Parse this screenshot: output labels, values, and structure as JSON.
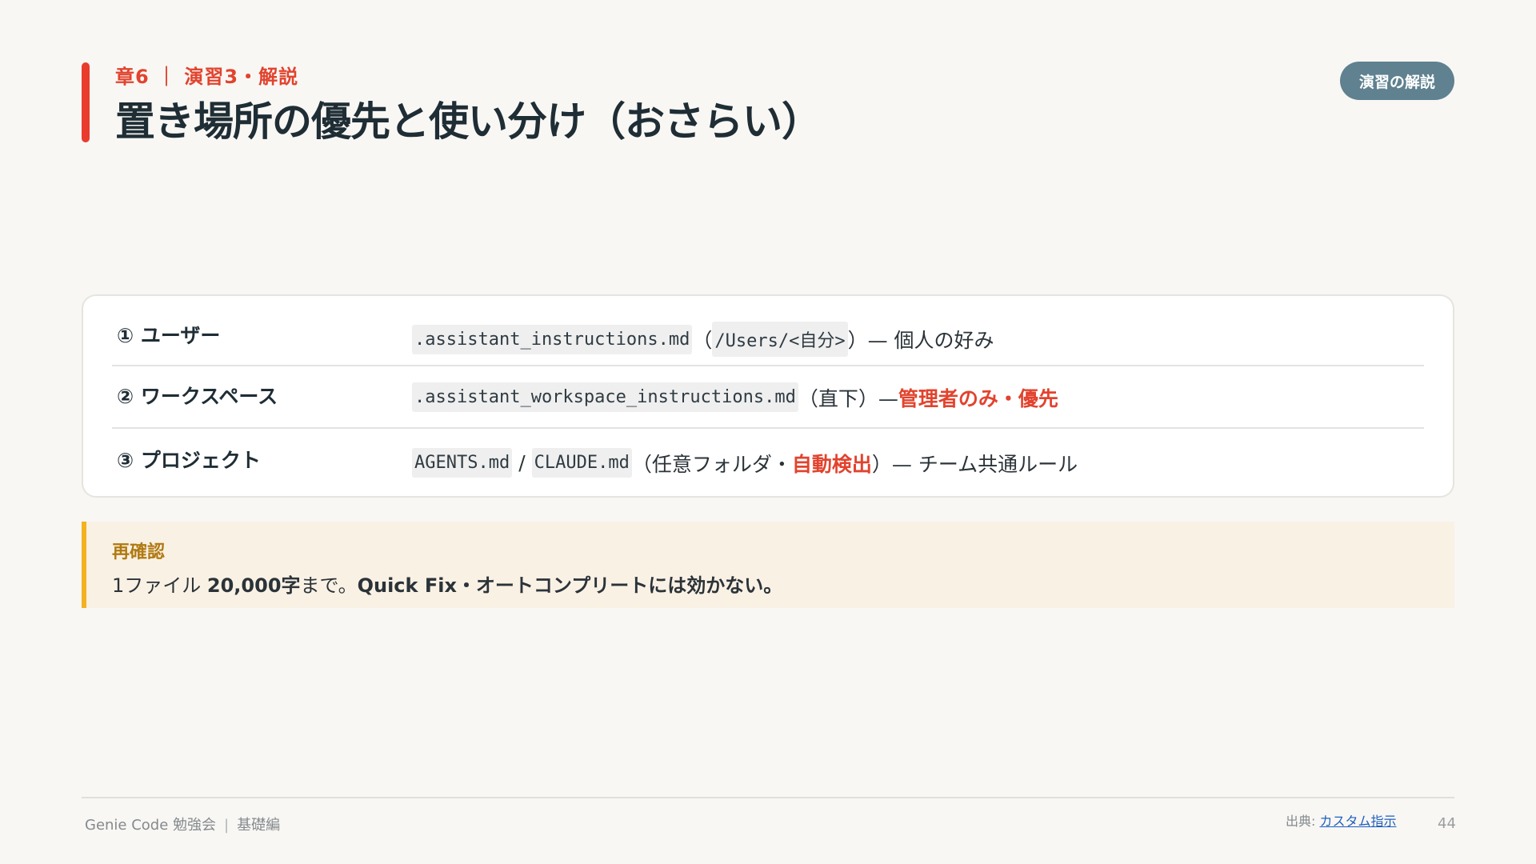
{
  "header": {
    "kicker": "章6 ｜ 演習3・解説",
    "title": "置き場所の優先と使い分け（おさらい）",
    "badge": "演習の解説"
  },
  "table": {
    "rows": [
      {
        "label": "① ユーザー",
        "code1": ".assistant_instructions.md",
        "paren_open": "（",
        "code_path": "/Users/<自分>",
        "rest": "）— 個人の好み"
      },
      {
        "label": "② ワークスペース",
        "code1": ".assistant_workspace_instructions.md",
        "rest": "（直下）— ",
        "highlight": "管理者のみ・優先"
      },
      {
        "label": "③ プロジェクト",
        "code1": "AGENTS.md",
        "slash": "/",
        "code2": "CLAUDE.md",
        "rest_before": "（任意フォルダ・",
        "highlight": "自動検出",
        "rest_after": "）— チーム共通ルール"
      }
    ]
  },
  "note": {
    "title": "再確認",
    "prefix": "1ファイル ",
    "bold1": "20,000字",
    "mid": "まで。",
    "bold2": "Quick Fix・オートコンプリートには効かない。"
  },
  "footer": {
    "left_a": "Genie Code 勉強会",
    "pipe": "|",
    "left_b": "基礎編",
    "source_label": "出典: ",
    "source_link": "カスタム指示",
    "page_number": "44"
  },
  "colors": {
    "accent": "#ea3c2c",
    "badge": "#5f8190",
    "note_border": "#f3b21f",
    "note_bg": "#faf1e5"
  }
}
